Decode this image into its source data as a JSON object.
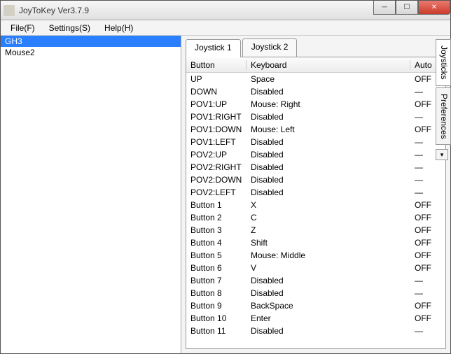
{
  "title": "JoyToKey Ver3.7.9",
  "menu": {
    "file": "File(F)",
    "settings": "Settings(S)",
    "help": "Help(H)"
  },
  "devices": [
    "GH3",
    "Mouse2"
  ],
  "selected_device": 0,
  "tabs": [
    "Joystick 1",
    "Joystick 2"
  ],
  "active_tab": 0,
  "columns": {
    "button": "Button",
    "keyboard": "Keyboard",
    "auto": "Auto"
  },
  "right_tabs": [
    "Joysticks",
    "Preferences"
  ],
  "rows": [
    {
      "button": "UP",
      "keyboard": "Space",
      "auto": "OFF"
    },
    {
      "button": "DOWN",
      "keyboard": "Disabled",
      "auto": "—"
    },
    {
      "button": "POV1:UP",
      "keyboard": "Mouse: Right",
      "auto": "OFF"
    },
    {
      "button": "POV1:RIGHT",
      "keyboard": "Disabled",
      "auto": "—"
    },
    {
      "button": "POV1:DOWN",
      "keyboard": "Mouse: Left",
      "auto": "OFF"
    },
    {
      "button": "POV1:LEFT",
      "keyboard": "Disabled",
      "auto": "—"
    },
    {
      "button": "POV2:UP",
      "keyboard": "Disabled",
      "auto": "—"
    },
    {
      "button": "POV2:RIGHT",
      "keyboard": "Disabled",
      "auto": "—"
    },
    {
      "button": "POV2:DOWN",
      "keyboard": "Disabled",
      "auto": "—"
    },
    {
      "button": "POV2:LEFT",
      "keyboard": "Disabled",
      "auto": "—"
    },
    {
      "button": "Button 1",
      "keyboard": "X",
      "auto": "OFF"
    },
    {
      "button": "Button 2",
      "keyboard": "C",
      "auto": "OFF"
    },
    {
      "button": "Button 3",
      "keyboard": "Z",
      "auto": "OFF"
    },
    {
      "button": "Button 4",
      "keyboard": "Shift",
      "auto": "OFF"
    },
    {
      "button": "Button 5",
      "keyboard": "Mouse: Middle",
      "auto": "OFF"
    },
    {
      "button": "Button 6",
      "keyboard": "V",
      "auto": "OFF"
    },
    {
      "button": "Button 7",
      "keyboard": "Disabled",
      "auto": "—"
    },
    {
      "button": "Button 8",
      "keyboard": "Disabled",
      "auto": "—"
    },
    {
      "button": "Button 9",
      "keyboard": "BackSpace",
      "auto": "OFF"
    },
    {
      "button": "Button 10",
      "keyboard": "Enter",
      "auto": "OFF"
    },
    {
      "button": "Button 11",
      "keyboard": "Disabled",
      "auto": "—"
    }
  ]
}
